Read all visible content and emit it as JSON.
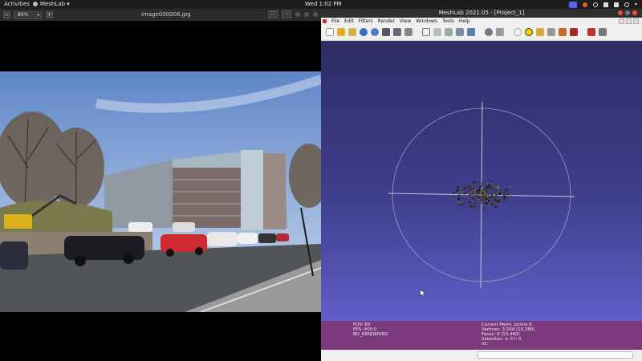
{
  "topbar": {
    "activities": "Activities",
    "app_name": "MeshLab",
    "clock": "Wed  1:02 PM"
  },
  "viewer": {
    "filename": "image000006.jpg",
    "zoom": "80%"
  },
  "meshlab": {
    "window_title": "MeshLab 2021.05 - [Project_1]",
    "menu": [
      "File",
      "Edit",
      "Filters",
      "Render",
      "View",
      "Windows",
      "Tools",
      "Help"
    ],
    "info_left": [
      "FOV: 60",
      "FPS:   400.0",
      "BO_RENDERING"
    ],
    "info_right": [
      "Current Mesh: points 6",
      "Vertices: 3,564    (10,380)",
      "Faces: 0     (13,440)",
      "Selection: v: 0 f: 0",
      "VC"
    ]
  },
  "colors": {
    "canvas_top": "#2e2d66",
    "canvas_bottom": "#5f5fc8",
    "info_bar": "#7a3a7b"
  }
}
